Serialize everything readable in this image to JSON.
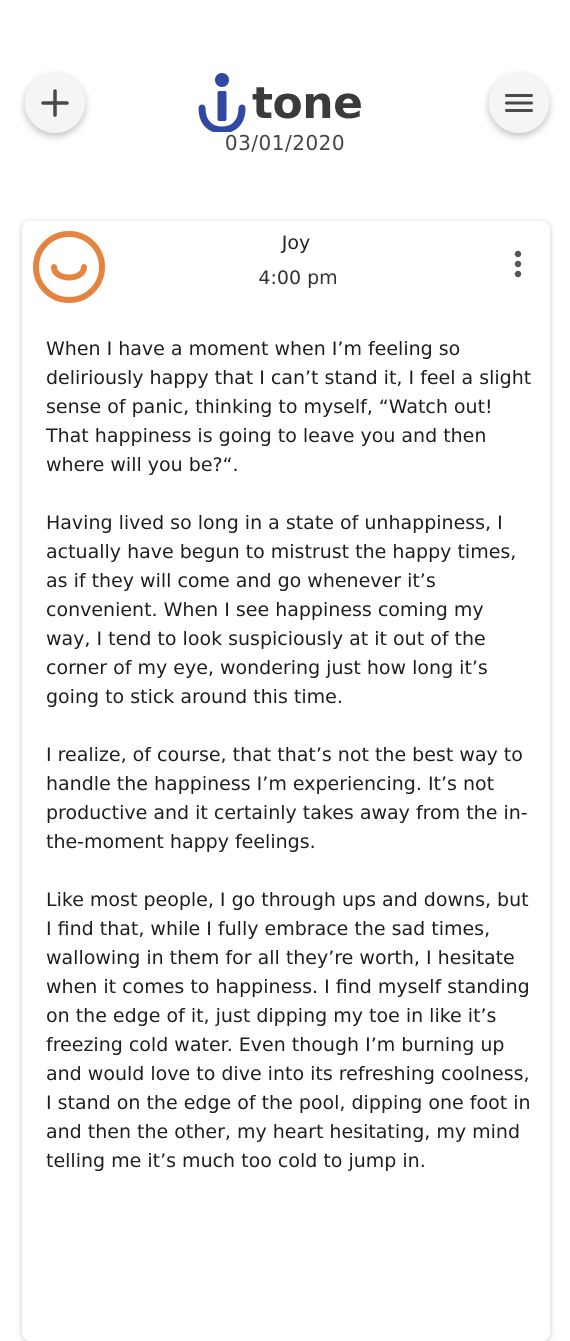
{
  "app": {
    "name": "tone",
    "date": "03/01/2020"
  },
  "icons": {
    "add": "plus-icon",
    "menu": "hamburger-menu-icon",
    "mood": "smiley-face-icon",
    "more": "vertical-dots-icon"
  },
  "colors": {
    "brand": "#2f49a4",
    "mood_joy": "#e5843e",
    "text": "#1e1e1e"
  },
  "entry": {
    "mood": "Joy",
    "time": "4:00 pm",
    "paragraphs": [
      "When I have a moment when I’m feeling so deliriously happy that I can’t stand it, I feel a slight sense of panic, thinking to myself, “Watch out! That happiness is going to leave you and then where will you be?“.",
      "Having lived so long in a state of unhappiness, I actually have begun to mistrust the happy times, as if they will come and go whenever it’s convenient. When I see happiness coming my way, I tend to look suspiciously at it out of the corner of my eye, wondering just how long it’s going to stick around this time.",
      "I realize, of course, that that’s not the best way to handle the happiness I’m experiencing. It’s not productive and it certainly takes away from the in-the-moment happy feelings.",
      "Like most people, I go through ups and downs, but I find that, while I fully embrace the sad times, wallowing in them for all they’re worth, I hesitate when it comes to happiness. I find myself standing on the edge of it, just dipping my toe in like it’s freezing cold water. Even though I’m burning up and would love to dive into its refreshing coolness, I stand on the edge of the pool, dipping one foot in and then the other, my heart hesitating, my mind telling me it’s much too cold to jump in."
    ]
  }
}
